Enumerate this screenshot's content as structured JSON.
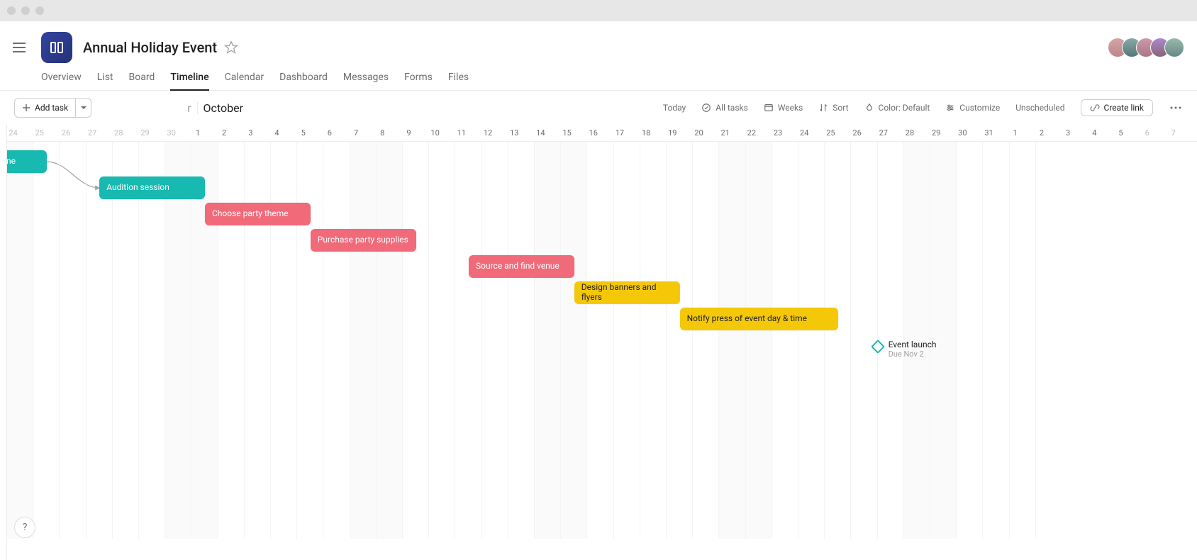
{
  "project_title": "Annual Holiday Event",
  "tabs": [
    "Overview",
    "List",
    "Board",
    "Timeline",
    "Calendar",
    "Dashboard",
    "Messages",
    "Forms",
    "Files"
  ],
  "active_tab": "Timeline",
  "toolbar": {
    "add_task": "Add task",
    "today": "Today",
    "all_tasks": "All tasks",
    "weeks": "Weeks",
    "sort": "Sort",
    "color": "Color: Default",
    "customize": "Customize",
    "unscheduled": "Unscheduled",
    "create_link": "Create link"
  },
  "month_prev_fragment": "r",
  "month_label": "October",
  "day_cells": [
    {
      "n": "24",
      "g": true
    },
    {
      "n": "25",
      "g": true
    },
    {
      "n": "26",
      "g": true
    },
    {
      "n": "27",
      "g": true
    },
    {
      "n": "28",
      "g": true
    },
    {
      "n": "29",
      "g": true
    },
    {
      "n": "30",
      "g": true
    },
    {
      "n": "1"
    },
    {
      "n": "2"
    },
    {
      "n": "3"
    },
    {
      "n": "4"
    },
    {
      "n": "5"
    },
    {
      "n": "6"
    },
    {
      "n": "7"
    },
    {
      "n": "8"
    },
    {
      "n": "9"
    },
    {
      "n": "10"
    },
    {
      "n": "11"
    },
    {
      "n": "12"
    },
    {
      "n": "13"
    },
    {
      "n": "14"
    },
    {
      "n": "15"
    },
    {
      "n": "16"
    },
    {
      "n": "17"
    },
    {
      "n": "18"
    },
    {
      "n": "19"
    },
    {
      "n": "20"
    },
    {
      "n": "21"
    },
    {
      "n": "22"
    },
    {
      "n": "23"
    },
    {
      "n": "24"
    },
    {
      "n": "25"
    },
    {
      "n": "26"
    },
    {
      "n": "27"
    },
    {
      "n": "28"
    },
    {
      "n": "29"
    },
    {
      "n": "30"
    },
    {
      "n": "31"
    },
    {
      "n": "1"
    },
    {
      "n": "2"
    },
    {
      "n": "3"
    },
    {
      "n": "4"
    },
    {
      "n": "5"
    },
    {
      "n": "6",
      "g": true
    },
    {
      "n": "7",
      "g": true
    }
  ],
  "weekend_indices": [
    0,
    6,
    7,
    13,
    14,
    20,
    21,
    27,
    28,
    34,
    35,
    41,
    42,
    44
  ],
  "tasks": [
    {
      "label": "Source talent to headline",
      "color": "teal",
      "start_idx": 2.5,
      "span": 5,
      "row": 0
    },
    {
      "label": "Audition session",
      "color": "teal",
      "start_idx": 9.5,
      "span": 4,
      "row": 1
    },
    {
      "label": "Choose party theme",
      "color": "pink",
      "start_idx": 13.5,
      "span": 4,
      "row": 2
    },
    {
      "label": "Purchase party supplies",
      "color": "pink",
      "start_idx": 17.5,
      "span": 4,
      "row": 3,
      "two": true
    },
    {
      "label": "Source and find venue",
      "color": "pink",
      "start_idx": 23.5,
      "span": 4,
      "row": 4
    },
    {
      "label": "Design banners and flyers",
      "color": "yellow",
      "start_idx": 27.5,
      "span": 4,
      "row": 5,
      "two": true
    },
    {
      "label": "Notify press of event day & time",
      "color": "yellow",
      "start_idx": 31.5,
      "span": 6,
      "row": 6
    }
  ],
  "milestone": {
    "label": "Event launch",
    "sub": "Due Nov 2",
    "idx": 39
  }
}
